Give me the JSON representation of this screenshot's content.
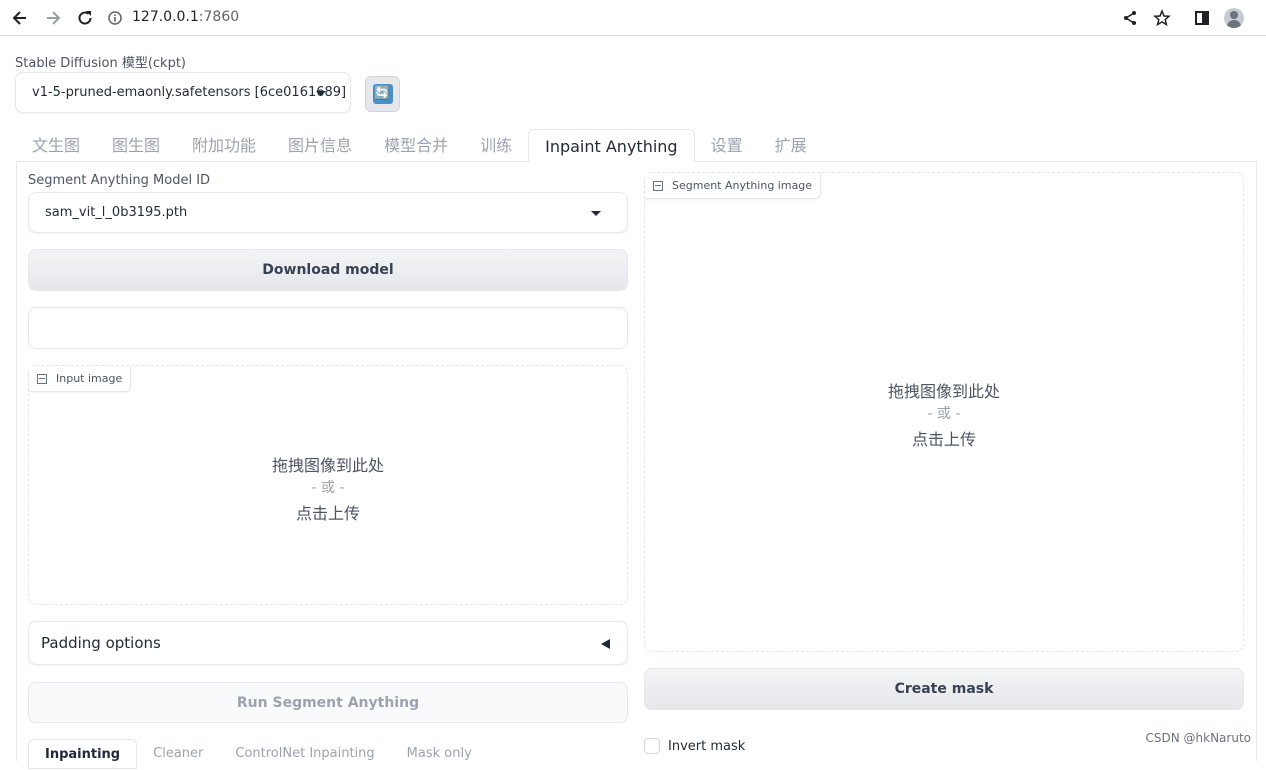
{
  "browser": {
    "host": "127.0.0.1",
    "port": ":7860"
  },
  "checkpoint": {
    "label": "Stable Diffusion 模型(ckpt)",
    "value": "v1-5-pruned-emaonly.safetensors [6ce0161689]",
    "refresh_icon": "🔄"
  },
  "tabs": [
    {
      "label": "文生图"
    },
    {
      "label": "图生图"
    },
    {
      "label": "附加功能"
    },
    {
      "label": "图片信息"
    },
    {
      "label": "模型合并"
    },
    {
      "label": "训练"
    },
    {
      "label": "Inpaint Anything",
      "active": true
    },
    {
      "label": "设置"
    },
    {
      "label": "扩展"
    }
  ],
  "left": {
    "sam_label": "Segment Anything Model ID",
    "sam_value": "sam_vit_l_0b3195.pth",
    "download_label": "Download model",
    "status_text": "",
    "input_image": {
      "badge": "Input image",
      "drop_main": "拖拽图像到此处",
      "drop_or": "- 或 -",
      "drop_click": "点击上传"
    },
    "padding_label": "Padding options",
    "run_label": "Run Segment Anything",
    "subtabs": [
      {
        "label": "Inpainting",
        "active": true
      },
      {
        "label": "Cleaner"
      },
      {
        "label": "ControlNet Inpainting"
      },
      {
        "label": "Mask only"
      }
    ]
  },
  "right": {
    "seg_image": {
      "badge": "Segment Anything image",
      "drop_main": "拖拽图像到此处",
      "drop_or": "- 或 -",
      "drop_click": "点击上传"
    },
    "create_mask_label": "Create mask",
    "invert_mask_label": "Invert mask"
  },
  "watermark": "CSDN @hkNaruto"
}
